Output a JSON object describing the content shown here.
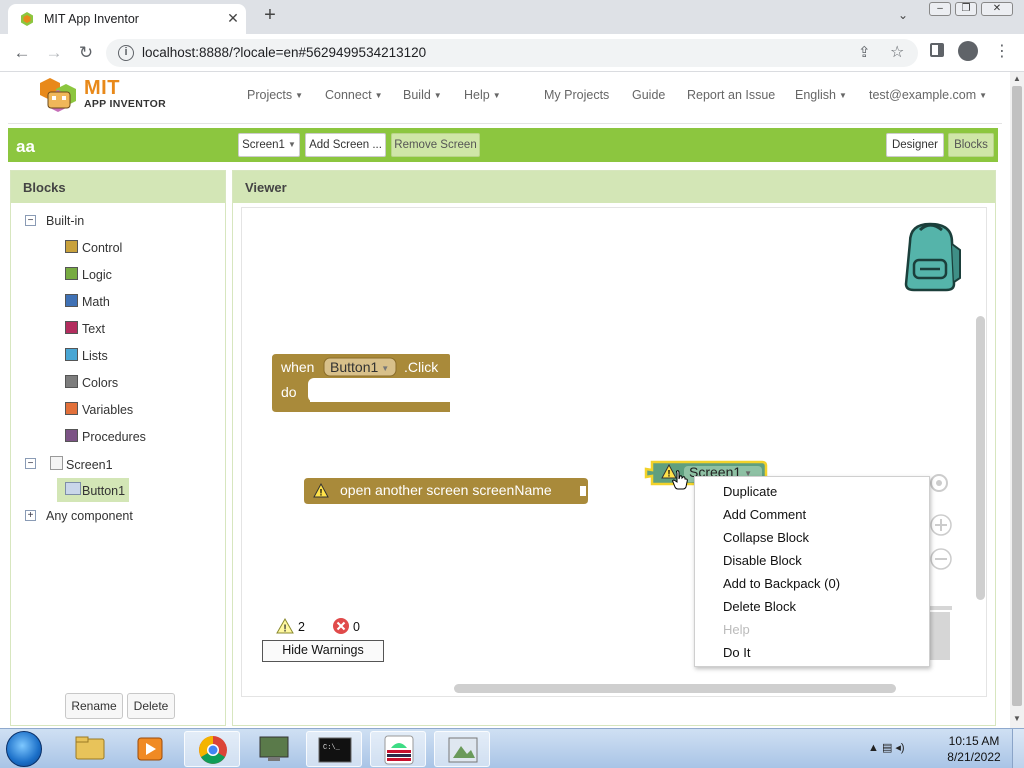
{
  "browser": {
    "tab_title": "MIT App Inventor",
    "url": "localhost:8888/?locale=en#5629499534213120"
  },
  "header": {
    "logo_mit": "MIT",
    "logo_ai": "APP INVENTOR",
    "menu": {
      "projects": "Projects",
      "connect": "Connect",
      "build": "Build",
      "help": "Help",
      "my_projects": "My Projects",
      "guide": "Guide",
      "report": "Report an Issue",
      "language": "English",
      "account": "test@example.com"
    }
  },
  "project_bar": {
    "name": "aa",
    "screen_select": "Screen1",
    "add_screen": "Add Screen ...",
    "remove_screen": "Remove Screen",
    "designer": "Designer",
    "blocks": "Blocks"
  },
  "blocks_panel": {
    "title": "Blocks",
    "builtin": "Built-in",
    "categories": [
      {
        "label": "Control",
        "color": "#c8a13c"
      },
      {
        "label": "Logic",
        "color": "#77ab41"
      },
      {
        "label": "Math",
        "color": "#3f71b5"
      },
      {
        "label": "Text",
        "color": "#b32d5e"
      },
      {
        "label": "Lists",
        "color": "#49a6d4"
      },
      {
        "label": "Colors",
        "color": "#7d7d7d"
      },
      {
        "label": "Variables",
        "color": "#e2703a"
      },
      {
        "label": "Procedures",
        "color": "#7c5385"
      }
    ],
    "screen": "Screen1",
    "component": "Button1",
    "any_component": "Any component",
    "rename": "Rename",
    "delete": "Delete"
  },
  "viewer": {
    "title": "Viewer",
    "event_block": {
      "when": "when",
      "component": "Button1",
      "event": ".Click",
      "do": "do"
    },
    "open_screen_block": {
      "text": "open another screen  screenName"
    },
    "screen_block": {
      "text": "Screen1"
    },
    "warnings_count": "2",
    "errors_count": "0",
    "hide_warnings": "Hide Warnings"
  },
  "context_menu": [
    {
      "label": "Duplicate",
      "enabled": true
    },
    {
      "label": "Add Comment",
      "enabled": true
    },
    {
      "label": "Collapse Block",
      "enabled": true
    },
    {
      "label": "Disable Block",
      "enabled": true
    },
    {
      "label": "Add to Backpack (0)",
      "enabled": true
    },
    {
      "label": "Delete Block",
      "enabled": true
    },
    {
      "label": "Help",
      "enabled": false
    },
    {
      "label": "Do It",
      "enabled": true
    }
  ],
  "taskbar": {
    "time": "10:15 AM",
    "date": "8/21/2022"
  },
  "colors": {
    "green_bar": "#8cc63f",
    "panel_head": "#d3e6b6",
    "block_gold": "#a98a3a",
    "screen_block": "#5f9f7f"
  }
}
